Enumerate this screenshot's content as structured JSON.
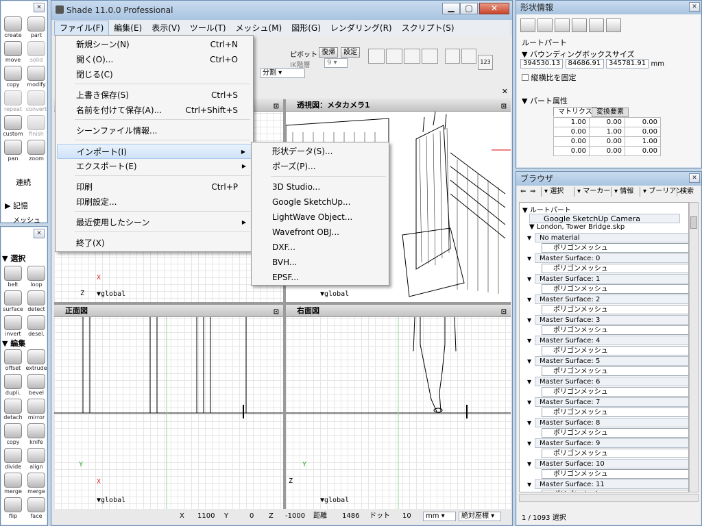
{
  "app_window": {
    "title": "Shade 11.0.0 Professional"
  },
  "menubar": [
    "ファイル(F)",
    "編集(E)",
    "表示(V)",
    "ツール(T)",
    "メッシュ(M)",
    "図形(G)",
    "レンダリング(R)",
    "スクリプト(S)"
  ],
  "file_menu": {
    "items": [
      {
        "label": "新規シーン(N)",
        "shortcut": "Ctrl+N"
      },
      {
        "label": "開く(O)...",
        "shortcut": "Ctrl+O"
      },
      {
        "label": "閉じる(C)",
        "shortcut": ""
      },
      {
        "label": "上書き保存(S)",
        "shortcut": "Ctrl+S"
      },
      {
        "label": "名前を付けて保存(A)...",
        "shortcut": "Ctrl+Shift+S"
      },
      {
        "label": "シーンファイル情報...",
        "shortcut": ""
      },
      {
        "label": "インポート(I)",
        "shortcut": ""
      },
      {
        "label": "エクスポート(E)",
        "shortcut": ""
      },
      {
        "label": "印刷",
        "shortcut": "Ctrl+P"
      },
      {
        "label": "印刷設定...",
        "shortcut": ""
      },
      {
        "label": "最近使用したシーン",
        "shortcut": ""
      },
      {
        "label": "終了(X)",
        "shortcut": ""
      }
    ]
  },
  "import_submenu": [
    "形状データ(S)...",
    "ポーズ(P)...",
    "3D Studio...",
    "Google SketchUp...",
    "LightWave Object...",
    "Wavefront OBJ...",
    "DXF...",
    "BVH...",
    "EPSF..."
  ],
  "toolbar": {
    "pivot": "ピボット",
    "restore": "復帰",
    "settings": "設定",
    "ik_level": "IK階層",
    "ik_value": "9",
    "split": "分割",
    "count_btn": "123"
  },
  "viewports": {
    "perspective_title": "透視図：メタカメラ1",
    "front_title": "正面図",
    "right_title": "右面図",
    "global": "▼global",
    "axis_x": "X",
    "axis_y": "Y",
    "axis_z": "Z"
  },
  "statusbar": {
    "x_label": "X",
    "x_value": "1100",
    "y_label": "Y",
    "y_value": "0",
    "z_label": "Z",
    "z_value": "-1000",
    "dist_label": "距離",
    "dist_value": "1486",
    "dot_label": "ドット",
    "dot_value": "10",
    "unit": "mm",
    "coord_mode": "絶対座標"
  },
  "tools": {
    "row1": [
      "create",
      "part"
    ],
    "row2": [
      "move",
      "solid"
    ],
    "row3": [
      "copy",
      "modify"
    ],
    "row4": [
      "repeat",
      "convert"
    ],
    "row5": [
      "custom",
      "finish"
    ],
    "row6": [
      "pan",
      "zoom"
    ],
    "renzoku": "連続",
    "kioku": "記憶",
    "mesh_tab": "メッシュ"
  },
  "mesh_palette": {
    "select_section": "選択",
    "edit_section": "編集",
    "select_tools": [
      "belt",
      "loop",
      "surface",
      "detect",
      "invert",
      "desel."
    ],
    "edit_tools": [
      "offset",
      "extrude",
      "dupli.",
      "bevel",
      "detach",
      "mirror",
      "copy",
      "knife",
      "divide",
      "align",
      "merge",
      "merge",
      "flip",
      "face"
    ]
  },
  "shape_info": {
    "title": "形状情報",
    "part_name": "ルートパート",
    "bbox_label": "▼ バウンディングボックスサイズ",
    "bbox": [
      "394530.13",
      "84686.91",
      "345781.91"
    ],
    "unit": "mm",
    "keep_ratio": "縦横比を固定",
    "part_attr": "▼ パート属性",
    "tab_matrix": "マトリクス",
    "tab_transform": "変換要素",
    "matrix": [
      [
        "1.00",
        "0.00",
        "0.00"
      ],
      [
        "0.00",
        "1.00",
        "0.00"
      ],
      [
        "0.00",
        "0.00",
        "1.00"
      ],
      [
        "0.00",
        "0.00",
        "0.00"
      ]
    ]
  },
  "browser": {
    "title": "ブラウザ",
    "toolbar": [
      "選択",
      "マーカー",
      "情報",
      "ブーリアン",
      "検索"
    ],
    "root": "ルートパート",
    "camera": "Google SketchUp Camera",
    "file": "London, Tower Bridge.skp",
    "groups": [
      "No material",
      "Master Surface: 0",
      "Master Surface: 1",
      "Master Surface: 2",
      "Master Surface: 3",
      "Master Surface: 4",
      "Master Surface: 5",
      "Master Surface: 6",
      "Master Surface: 7",
      "Master Surface: 8",
      "Master Surface: 9",
      "Master Surface: 10",
      "Master Surface: 11"
    ],
    "mesh_label": "ポリゴンメッシュ",
    "status": "1 / 1093 選択"
  }
}
